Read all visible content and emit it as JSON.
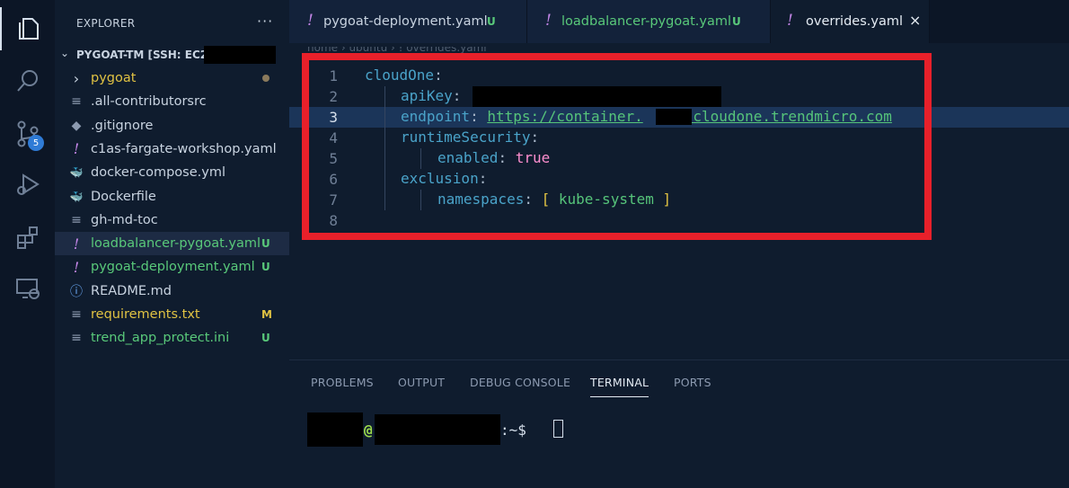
{
  "activity_bar": {
    "icons": [
      "files-icon",
      "search-icon",
      "source-control-icon",
      "run-debug-icon",
      "extensions-icon",
      "remote-explorer-icon"
    ],
    "source_control_badge": "5"
  },
  "sidebar": {
    "title": "EXPLORER",
    "more_label": "···",
    "workspace_label": "PYGOAT-TM [SSH: EC2-",
    "files": [
      {
        "name": "pygoat",
        "icon": "chevron-right-icon",
        "icon_glyph": "›",
        "color": "#e0c243",
        "status": "",
        "dot": true,
        "selected": false
      },
      {
        "name": ".all-contributorsrc",
        "icon": "lines-icon",
        "icon_glyph": "≡",
        "color": "#c8d3e0",
        "status": "",
        "dot": false,
        "selected": false
      },
      {
        "name": ".gitignore",
        "icon": "git-icon",
        "icon_glyph": "◆",
        "color": "#c8d3e0",
        "status": "",
        "dot": false,
        "selected": false
      },
      {
        "name": "c1as-fargate-workshop.yaml",
        "icon": "yaml-icon",
        "icon_glyph": "!",
        "color": "#c8d3e0",
        "status": "",
        "dot": false,
        "selected": false
      },
      {
        "name": "docker-compose.yml",
        "icon": "docker-compose-icon",
        "icon_glyph": "🐳",
        "color": "#c8d3e0",
        "status": "",
        "dot": false,
        "selected": false
      },
      {
        "name": "Dockerfile",
        "icon": "docker-icon",
        "icon_glyph": "🐳",
        "color": "#c8d3e0",
        "status": "",
        "dot": false,
        "selected": false
      },
      {
        "name": "gh-md-toc",
        "icon": "lines-icon",
        "icon_glyph": "≡",
        "color": "#c8d3e0",
        "status": "",
        "dot": false,
        "selected": false
      },
      {
        "name": "loadbalancer-pygoat.yaml",
        "icon": "yaml-icon",
        "icon_glyph": "!",
        "color": "#59c97a",
        "status": "U",
        "dot": false,
        "selected": true
      },
      {
        "name": "pygoat-deployment.yaml",
        "icon": "yaml-icon",
        "icon_glyph": "!",
        "color": "#59c97a",
        "status": "U",
        "dot": false,
        "selected": false
      },
      {
        "name": "README.md",
        "icon": "info-icon",
        "icon_glyph": "ⓘ",
        "color": "#c8d3e0",
        "status": "",
        "dot": false,
        "selected": false
      },
      {
        "name": "requirements.txt",
        "icon": "lines-icon",
        "icon_glyph": "≡",
        "color": "#e0c243",
        "status": "M",
        "dot": false,
        "selected": false
      },
      {
        "name": "trend_app_protect.ini",
        "icon": "lines-icon",
        "icon_glyph": "≡",
        "color": "#59c97a",
        "status": "U",
        "dot": false,
        "selected": false
      }
    ]
  },
  "tabs": [
    {
      "label": "pygoat-deployment.yaml",
      "status": "U",
      "active": false
    },
    {
      "label": "loadbalancer-pygoat.yaml",
      "status": "U",
      "active": false
    },
    {
      "label": "overrides.yaml",
      "status": "",
      "active": true,
      "close": "×"
    }
  ],
  "editor": {
    "breadcrumb": "home › ubuntu › ! overrides.yaml",
    "current_line": 3,
    "lines": [
      {
        "num": "1",
        "key": "cloudOne",
        "sep": ":",
        "value": "",
        "indent": 0
      },
      {
        "num": "2",
        "key": "apiKey",
        "sep": ":",
        "value": "",
        "indent": 1
      },
      {
        "num": "3",
        "key": "endpoint",
        "sep": ":",
        "value_a": "https://container.",
        "value_b": ".cloudone.trendmicro.com",
        "indent": 1
      },
      {
        "num": "4",
        "key": "runtimeSecurity",
        "sep": ":",
        "value": "",
        "indent": 1
      },
      {
        "num": "5",
        "key": "enabled",
        "sep": ":",
        "value": "true",
        "indent": 2
      },
      {
        "num": "6",
        "key": "exclusion",
        "sep": ":",
        "value": "",
        "indent": 1
      },
      {
        "num": "7",
        "key": "namespaces",
        "sep": ":",
        "open": "[",
        "value": "kube-system",
        "close": "]",
        "indent": 2
      },
      {
        "num": "8",
        "key": "",
        "sep": "",
        "value": "",
        "indent": 0
      }
    ]
  },
  "panel": {
    "tabs": [
      "PROBLEMS",
      "OUTPUT",
      "DEBUG CONSOLE",
      "TERMINAL",
      "PORTS"
    ],
    "active_tab": "TERMINAL",
    "terminal": {
      "at": "@",
      "prompt_suffix": ":~$"
    }
  },
  "colors": {
    "highlight_box": "#e8202a",
    "untracked": "#59c97a",
    "modified": "#e0c243",
    "yaml_bang": "#c486e8"
  }
}
